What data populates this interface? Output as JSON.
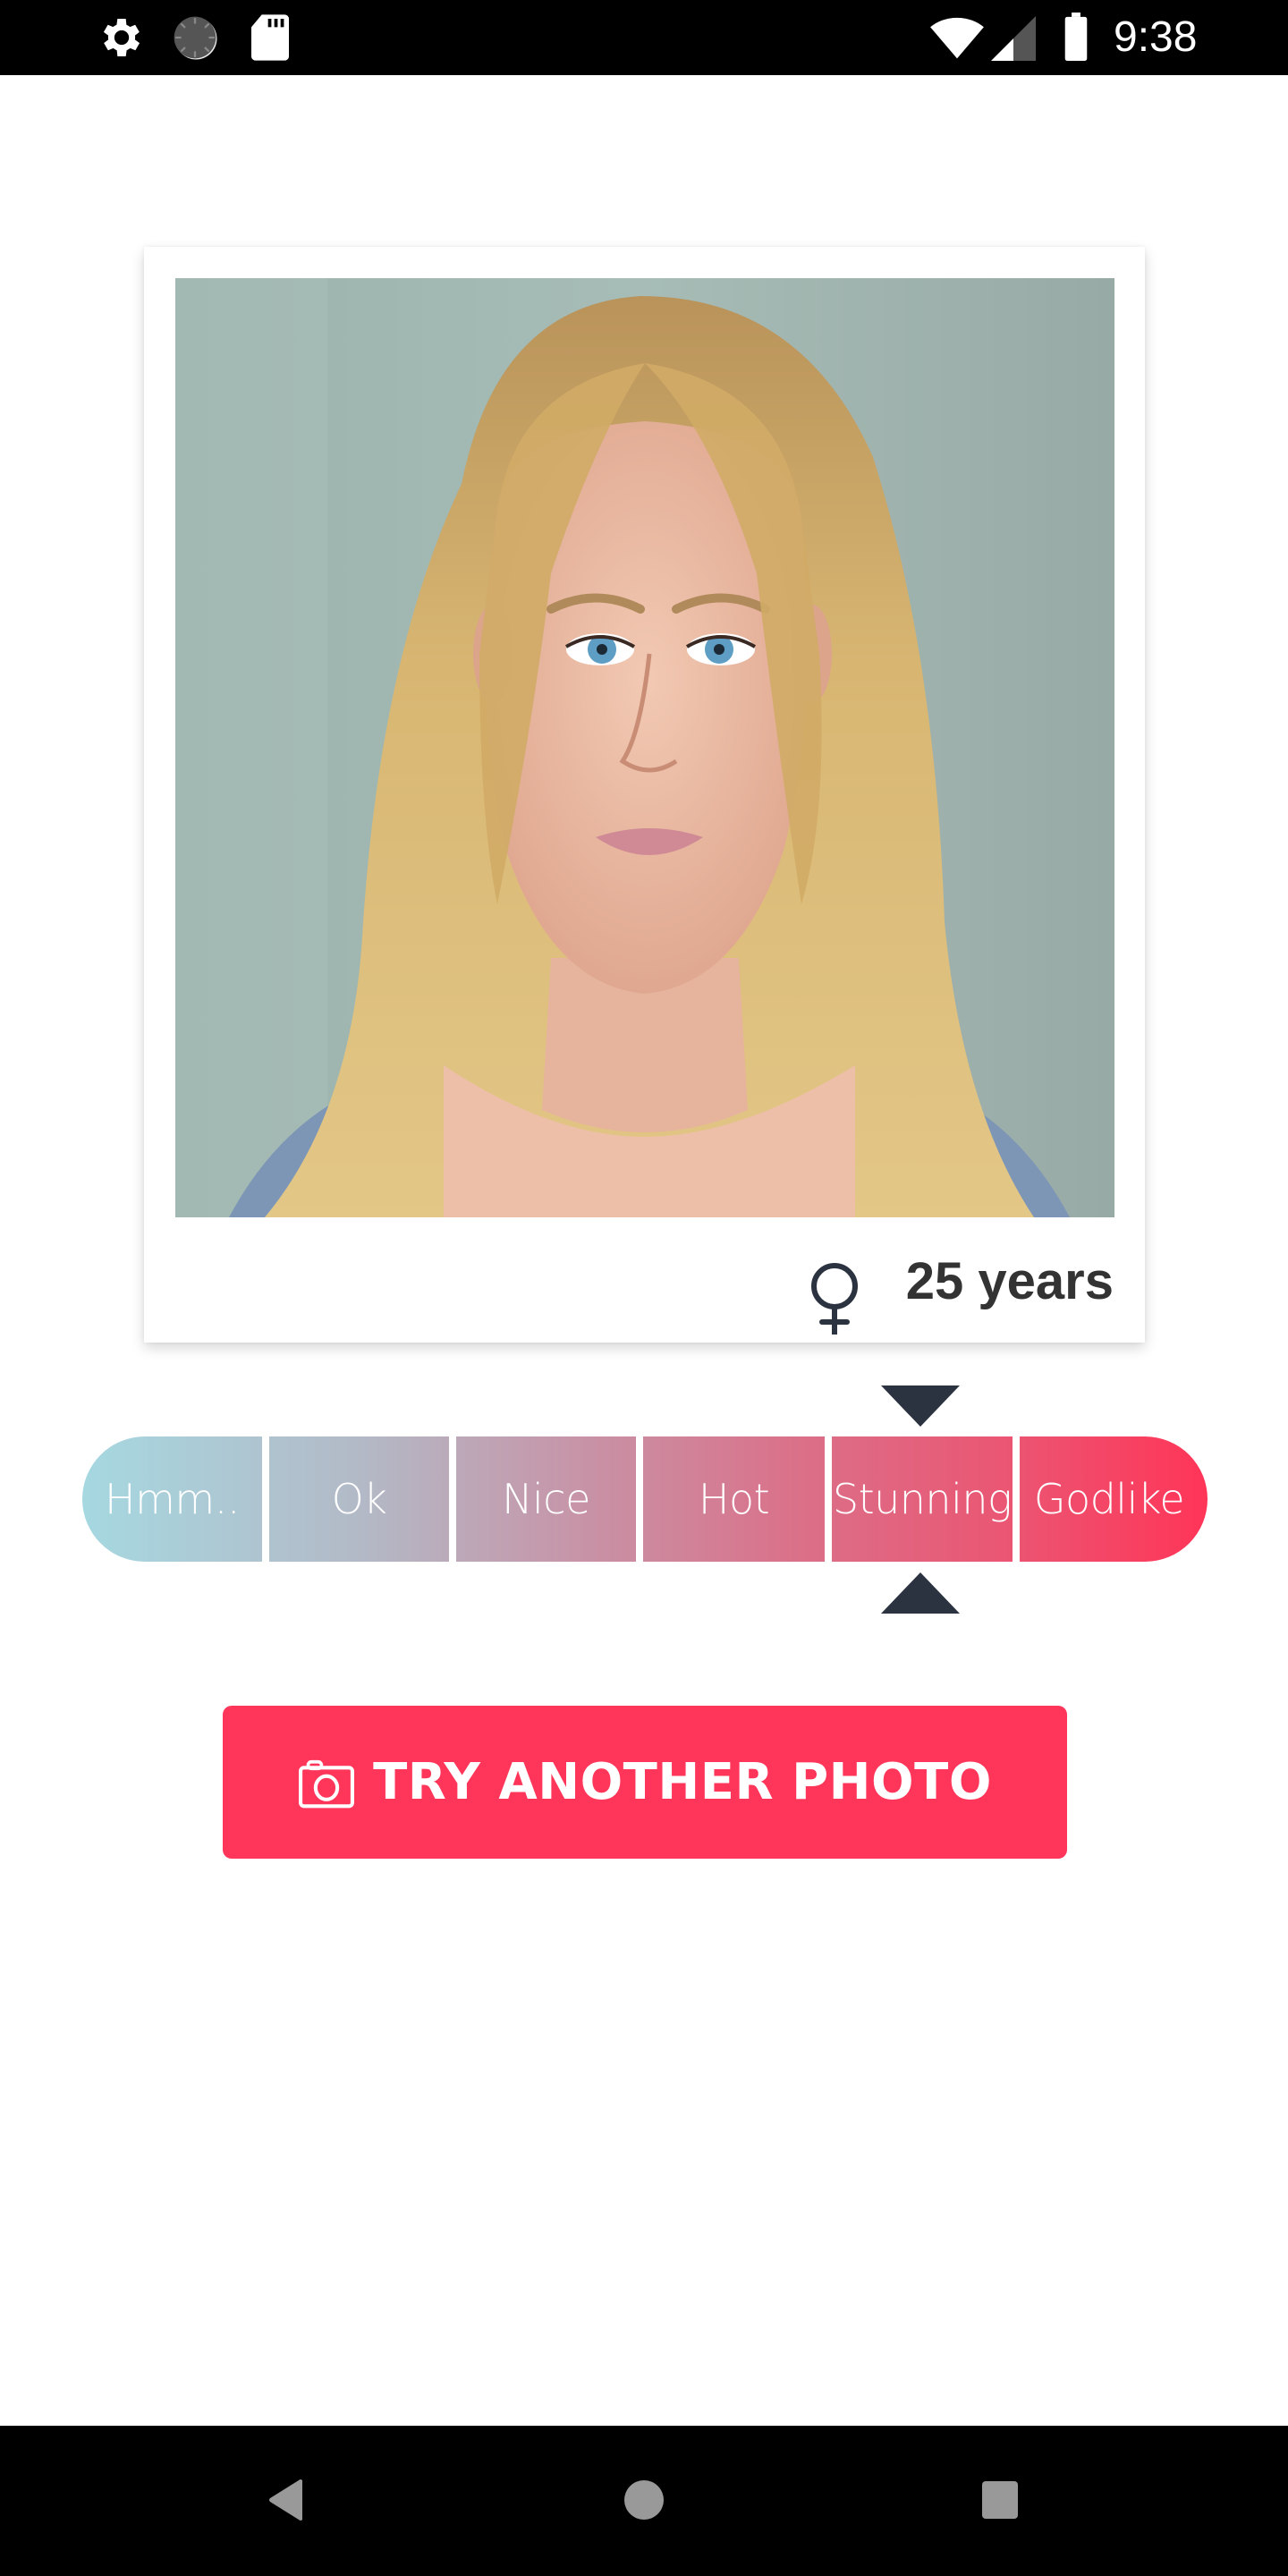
{
  "status_bar": {
    "time": "9:38",
    "left_icons": [
      "settings-icon",
      "sync-icon",
      "sd-card-icon"
    ],
    "right_icons": [
      "wifi-icon",
      "cell-signal-icon",
      "battery-icon"
    ]
  },
  "profile": {
    "photo_description": "Portrait photo of a blonde woman",
    "gender_icon": "female-symbol-icon",
    "age_label": "25 years"
  },
  "rating": {
    "levels": [
      {
        "label": "Hmm.."
      },
      {
        "label": "Ok"
      },
      {
        "label": "Nice"
      },
      {
        "label": "Hot"
      },
      {
        "label": "Stunning"
      },
      {
        "label": "Godlike"
      }
    ],
    "selected_index": 4,
    "selected_label": "Stunning",
    "gradient_start_color": "#a6d8e1",
    "gradient_end_color": "#ff3558",
    "pointer_color": "#2c3340"
  },
  "actions": {
    "try_another_label": "TRY ANOTHER PHOTO",
    "try_another_icon": "camera-icon",
    "button_color": "#ff3559"
  },
  "nav_bar": {
    "buttons": [
      "back-icon",
      "home-icon",
      "recents-icon"
    ]
  }
}
